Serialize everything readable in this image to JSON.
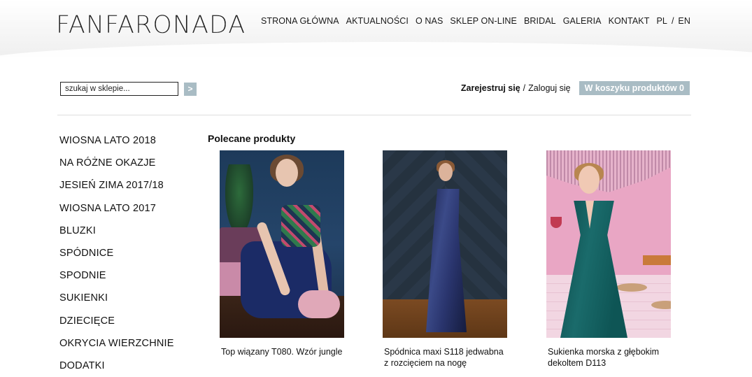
{
  "header": {
    "logo": "FANFARONADA",
    "nav": [
      "STRONA GŁÓWNA",
      "AKTUALNOŚCI",
      "O NAS",
      "SKLEP ON-LINE",
      "BRIDAL",
      "GALERIA",
      "KONTAKT"
    ],
    "lang": {
      "pl": "PL",
      "sep": "/",
      "en": "EN"
    }
  },
  "search": {
    "placeholder": "szukaj w sklepie...",
    "button": ">"
  },
  "account": {
    "register": "Zarejestruj się",
    "separator": "/",
    "login": "Zaloguj się",
    "cart": "W koszyku produktów 0"
  },
  "sidebar": {
    "items": [
      "WIOSNA LATO 2018",
      "NA RÓŻNE OKAZJE",
      "JESIEŃ ZIMA 2017/18",
      "WIOSNA LATO 2017",
      "BLUZKI",
      "SPÓDNICE",
      "SPODNIE",
      "SUKIENKI",
      "DZIECIĘCE",
      "OKRYCIA WIERZCHNIE",
      "DODATKI"
    ]
  },
  "main": {
    "title": "Polecane produkty",
    "products": [
      {
        "name": "Top wiązany T080. Wzór jungle"
      },
      {
        "name": "Spódnica maxi S118 jedwabna z rozcięciem na nogę"
      },
      {
        "name": "Sukienka morska z głębokim dekoltem D113"
      }
    ]
  },
  "colors": {
    "accent": "#a9bcc4",
    "text": "#111111",
    "divider": "#dddddd"
  }
}
